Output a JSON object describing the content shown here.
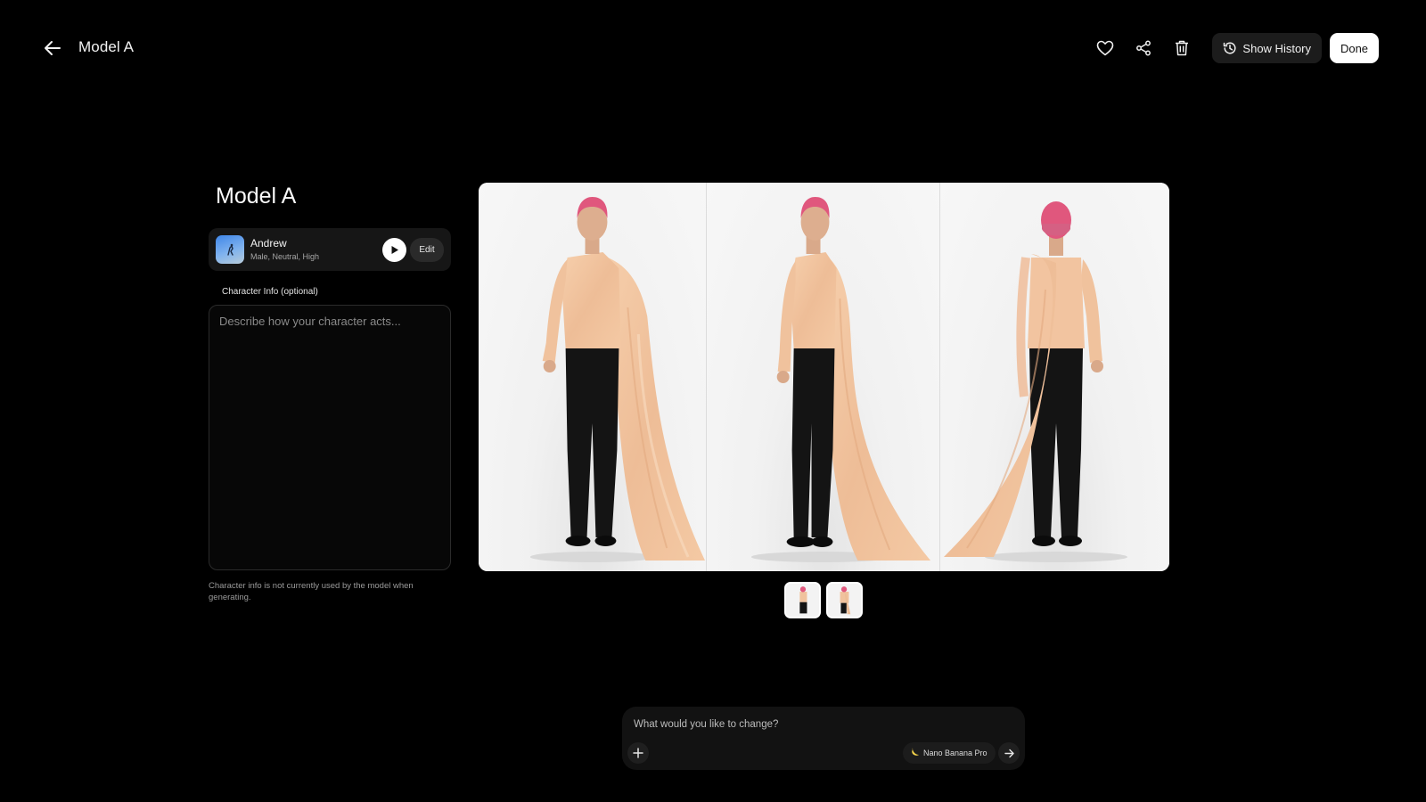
{
  "header": {
    "title": "Model A",
    "back_icon": "arrow-left-icon",
    "actions": {
      "favorite_icon": "heart-icon",
      "share_icon": "share-icon",
      "delete_icon": "trash-icon",
      "history_label": "Show History",
      "done_label": "Done"
    }
  },
  "panel": {
    "title": "Model A",
    "voice": {
      "name": "Andrew",
      "meta": "Male, Neutral, High",
      "edit_label": "Edit"
    },
    "character_info": {
      "label": "Character Info (optional)",
      "placeholder": "Describe how your character acts...",
      "value": "",
      "note": "Character info is not currently used by the model when generating."
    }
  },
  "preview": {
    "poses": [
      "front-three-quarter",
      "side-three-quarter",
      "back"
    ],
    "thumbnail_count": 2
  },
  "prompt": {
    "placeholder": "What would you like to change?",
    "model_chip": "Nano Banana Pro",
    "model_icon": "banana-icon"
  },
  "colors": {
    "background": "#000000",
    "shirt": "#f2c4a0",
    "hair": "#e0577d",
    "pants": "#141414"
  }
}
